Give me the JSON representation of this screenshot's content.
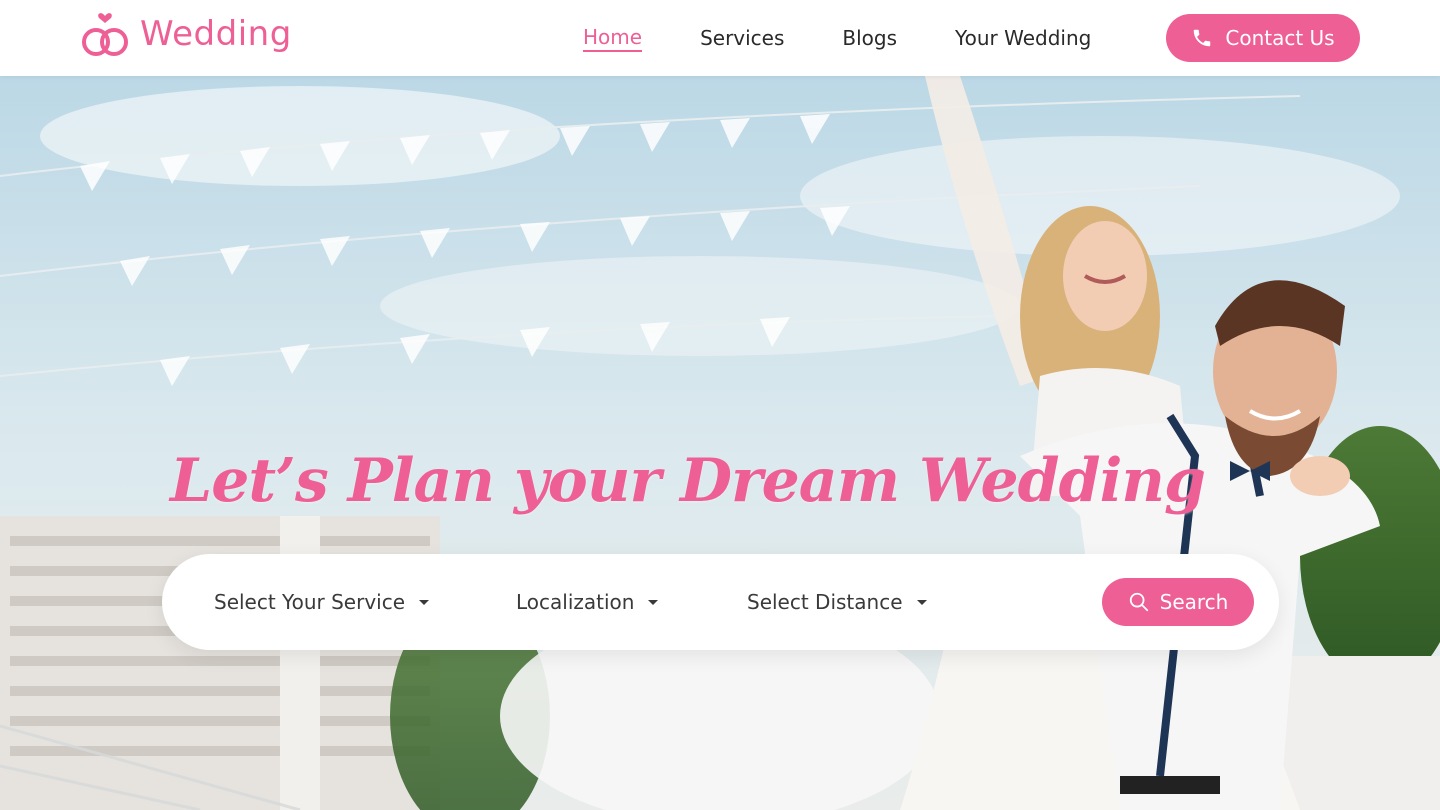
{
  "brand": {
    "name": "Wedding",
    "color": "#ee5f96",
    "icon": "wedding-rings-icon"
  },
  "nav": {
    "items": [
      {
        "label": "Home",
        "active": true
      },
      {
        "label": "Services",
        "active": false
      },
      {
        "label": "Blogs",
        "active": false
      },
      {
        "label": "Your Wedding",
        "active": false
      }
    ],
    "contact_label": "Contact Us",
    "contact_icon": "phone-icon"
  },
  "hero": {
    "headline": "Let’s Plan your Dream Wedding",
    "image": "happy-bride-and-groom-photo"
  },
  "search": {
    "service_label": "Select Your Service",
    "location_label": "Localization",
    "distance_label": "Select Distance",
    "button_label": "Search",
    "button_icon": "search-icon"
  }
}
